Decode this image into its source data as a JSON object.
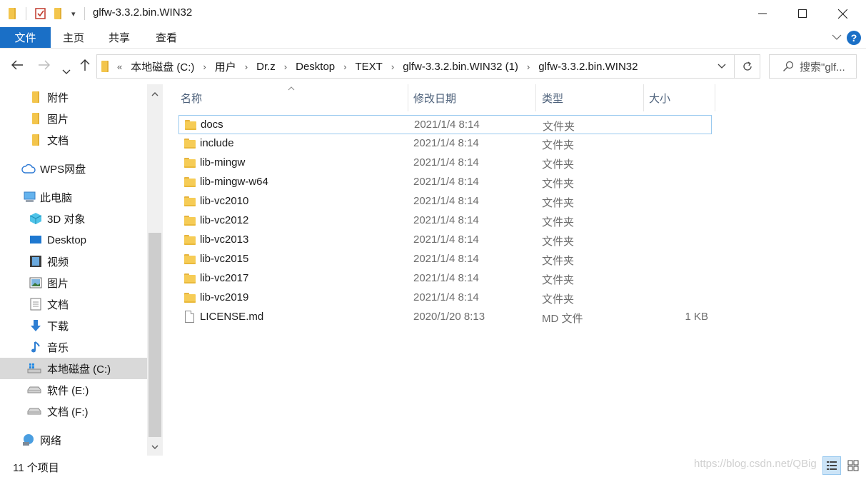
{
  "window": {
    "title": "glfw-3.3.2.bin.WIN32",
    "minimize": "—",
    "maximize": "☐",
    "close": "✕"
  },
  "ribbon": {
    "tabs": [
      "文件",
      "主页",
      "共享",
      "查看"
    ],
    "help": "?"
  },
  "address": {
    "prefix": "«",
    "crumbs": [
      "本地磁盘 (C:)",
      "用户",
      "Dr.z",
      "Desktop",
      "TEXT",
      "glfw-3.3.2.bin.WIN32 (1)",
      "glfw-3.3.2.bin.WIN32"
    ],
    "search_placeholder": "搜索\"glf..."
  },
  "sidebar": {
    "items": [
      {
        "label": "附件",
        "icon": "folder-icon"
      },
      {
        "label": "图片",
        "icon": "folder-icon"
      },
      {
        "label": "文档",
        "icon": "folder-icon"
      },
      {
        "label": "WPS网盘",
        "icon": "cloud-icon"
      },
      {
        "label": "此电脑",
        "icon": "computer-icon"
      },
      {
        "label": "3D 对象",
        "icon": "cube-icon"
      },
      {
        "label": "Desktop",
        "icon": "desktop-icon"
      },
      {
        "label": "视频",
        "icon": "video-icon"
      },
      {
        "label": "图片",
        "icon": "pictures-icon"
      },
      {
        "label": "文档",
        "icon": "documents-icon"
      },
      {
        "label": "下载",
        "icon": "download-icon"
      },
      {
        "label": "音乐",
        "icon": "music-icon"
      },
      {
        "label": "本地磁盘 (C:)",
        "icon": "windows-drive-icon"
      },
      {
        "label": "软件 (E:)",
        "icon": "drive-icon"
      },
      {
        "label": "文档 (F:)",
        "icon": "drive-icon"
      },
      {
        "label": "网络",
        "icon": "network-icon"
      }
    ]
  },
  "columns": {
    "name": "名称",
    "date": "修改日期",
    "type": "类型",
    "size": "大小"
  },
  "files": [
    {
      "name": "docs",
      "date": "2021/1/4 8:14",
      "type": "文件夹",
      "size": ""
    },
    {
      "name": "include",
      "date": "2021/1/4 8:14",
      "type": "文件夹",
      "size": ""
    },
    {
      "name": "lib-mingw",
      "date": "2021/1/4 8:14",
      "type": "文件夹",
      "size": ""
    },
    {
      "name": "lib-mingw-w64",
      "date": "2021/1/4 8:14",
      "type": "文件夹",
      "size": ""
    },
    {
      "name": "lib-vc2010",
      "date": "2021/1/4 8:14",
      "type": "文件夹",
      "size": ""
    },
    {
      "name": "lib-vc2012",
      "date": "2021/1/4 8:14",
      "type": "文件夹",
      "size": ""
    },
    {
      "name": "lib-vc2013",
      "date": "2021/1/4 8:14",
      "type": "文件夹",
      "size": ""
    },
    {
      "name": "lib-vc2015",
      "date": "2021/1/4 8:14",
      "type": "文件夹",
      "size": ""
    },
    {
      "name": "lib-vc2017",
      "date": "2021/1/4 8:14",
      "type": "文件夹",
      "size": ""
    },
    {
      "name": "lib-vc2019",
      "date": "2021/1/4 8:14",
      "type": "文件夹",
      "size": ""
    },
    {
      "name": "LICENSE.md",
      "date": "2020/1/20 8:13",
      "type": "MD 文件",
      "size": "1 KB"
    }
  ],
  "status": {
    "count": "11 个项目",
    "watermark": "https://blog.csdn.net/QBig"
  },
  "colors": {
    "accent": "#1a6fc6",
    "selection": "#cce4f7",
    "folder": "#f6cc56"
  }
}
